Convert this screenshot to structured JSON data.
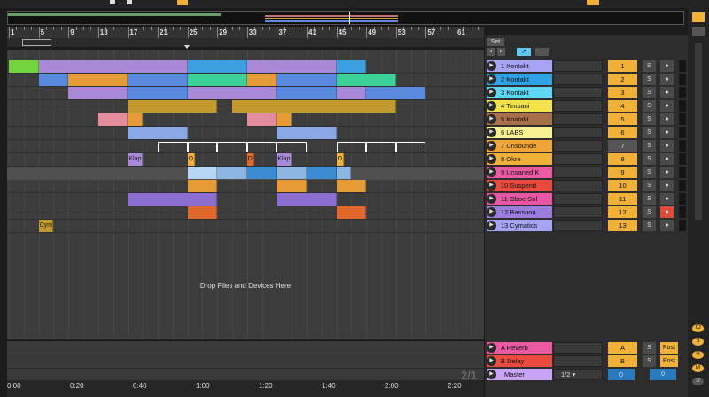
{
  "ruler": {
    "bars": [
      "1",
      "5",
      "9",
      "13",
      "17",
      "21",
      "25",
      "29",
      "33",
      "37",
      "41",
      "45",
      "49",
      "53",
      "57",
      "61"
    ]
  },
  "time_ruler": [
    "0:00",
    "0:20",
    "0:40",
    "1:00",
    "1:20",
    "1:40",
    "2:00",
    "2:20"
  ],
  "arrangement": {
    "drop_hint": "Drop Files and Devices Here",
    "counter": "2/1"
  },
  "mixer_header": {
    "set_label": "Set",
    "nav_left": "◂",
    "nav_right": "▸",
    "mode_icon": "↗",
    "lock_icon": "🔒"
  },
  "tracks": [
    {
      "name": "1 Kontakt",
      "color": "#a7a3f5",
      "number": "1",
      "solo": "S",
      "arm": "●"
    },
    {
      "name": "2 Kontakt",
      "color": "#2fa2e6",
      "number": "2",
      "solo": "S",
      "arm": "●"
    },
    {
      "name": "3 Kontakt",
      "color": "#5ed7f5",
      "number": "3",
      "solo": "S",
      "arm": "●"
    },
    {
      "name": "4 Timpani",
      "color": "#f4e24c",
      "number": "4",
      "solo": "S",
      "arm": "●"
    },
    {
      "name": "5 Kontakt",
      "color": "#a86f4a",
      "number": "5",
      "solo": "S",
      "arm": "●"
    },
    {
      "name": "6 LABS",
      "color": "#f7f192",
      "number": "6",
      "solo": "S",
      "arm": "●"
    },
    {
      "name": "7 Unsounde",
      "color": "#f0a536",
      "number": "7",
      "solo": "S",
      "arm": "●"
    },
    {
      "name": "8 Okre",
      "color": "#f1b139",
      "number": "8",
      "solo": "S",
      "arm": "●"
    },
    {
      "name": "9 Unsaned K",
      "color": "#e95aa3",
      "number": "9",
      "solo": "S",
      "arm": "●"
    },
    {
      "name": "10 Suspend",
      "color": "#ea4b3e",
      "number": "10",
      "solo": "S",
      "arm": "●"
    },
    {
      "name": "11 Oboe Sol",
      "color": "#e857a6",
      "number": "11",
      "solo": "S",
      "arm": "●"
    },
    {
      "name": "12 Bassoon",
      "color": "#9a7ddc",
      "number": "12",
      "solo": "S",
      "arm": "●"
    },
    {
      "name": "13 Cymatics",
      "color": "#a7a3f5",
      "number": "13",
      "solo": "S",
      "arm": "●"
    }
  ],
  "returns": [
    {
      "name": "A Reverb",
      "color": "#e95aa3",
      "letter": "A",
      "solo": "S",
      "post": "Post"
    },
    {
      "name": "B Delay",
      "color": "#ea4b3e",
      "letter": "B",
      "solo": "S",
      "post": "Post"
    }
  ],
  "master": {
    "name": "Master",
    "color": "#c9a3f5",
    "quantize": "1/2",
    "left_val": "0",
    "right_val": "0"
  },
  "clip_labels": {
    "klap1": "Klap",
    "klap2": "Klap",
    "cym": "Cym",
    "o1": "O",
    "o2": "O",
    "d": "D"
  },
  "right_panel": [
    "IO",
    "S",
    "R",
    "M",
    "D"
  ]
}
